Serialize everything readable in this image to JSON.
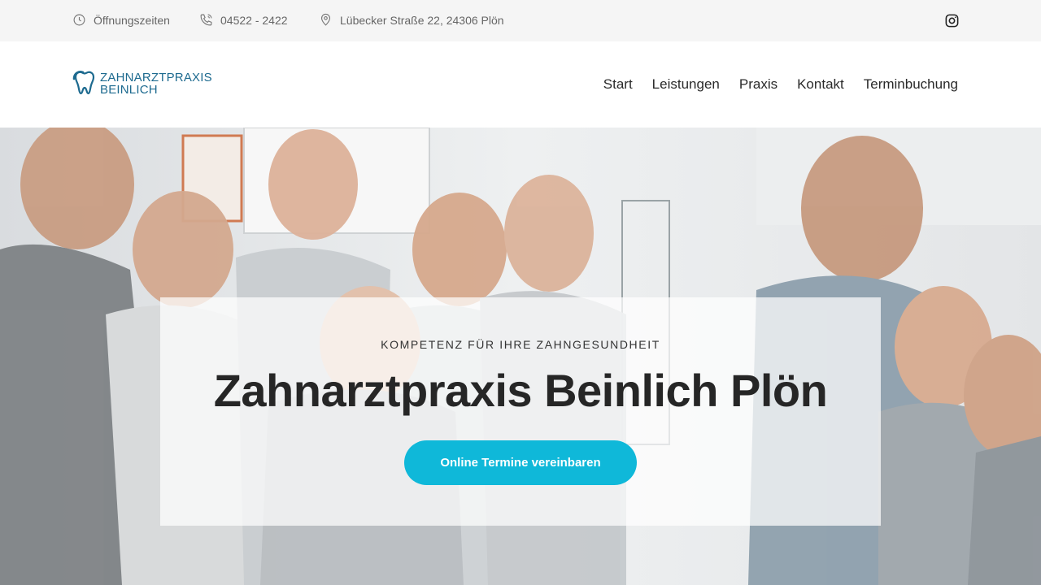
{
  "topbar": {
    "hours": "Öffnungszeiten",
    "phone": "04522 - 2422",
    "address": "Lübecker Straße 22,  24306 Plön",
    "icons": [
      "clock-icon",
      "phone-icon",
      "location-pin-icon",
      "instagram-icon"
    ]
  },
  "header": {
    "logo_line1": "ZAHNARZTPRAXIS",
    "logo_line2": "BEINLICH",
    "nav": [
      "Start",
      "Leistungen",
      "Praxis",
      "Kontakt",
      "Terminbuchung"
    ]
  },
  "hero": {
    "kicker": "KOMPETENZ FÜR IHRE ZAHNGESUNDHEIT",
    "headline": "Zahnarztpraxis Beinlich Plön",
    "cta": "Online Termine vereinbaren"
  },
  "colors": {
    "accent": "#0fb8d9",
    "brand": "#1d6a8f",
    "topbar_bg": "#f5f5f5"
  }
}
